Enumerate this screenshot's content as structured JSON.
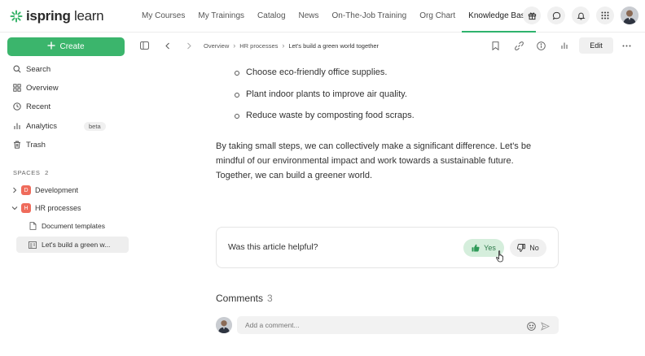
{
  "brand": {
    "name_bold": "ispring",
    "name_light": " learn",
    "color": "#3bb56c"
  },
  "topnav": {
    "items": [
      "My Courses",
      "My Trainings",
      "Catalog",
      "News",
      "On-The-Job Training",
      "Org Chart",
      "Knowledge Base"
    ],
    "active": "Knowledge Base",
    "icons": [
      "gift-icon",
      "chat-icon",
      "bell-icon",
      "apps-grid-icon",
      "user-avatar"
    ]
  },
  "sidebar": {
    "create_label": "Create",
    "items": [
      {
        "label": "Search",
        "icon": "search-icon"
      },
      {
        "label": "Overview",
        "icon": "overview-grid-icon"
      },
      {
        "label": "Recent",
        "icon": "clock-icon"
      },
      {
        "label": "Analytics",
        "icon": "analytics-icon",
        "badge": "beta"
      },
      {
        "label": "Trash",
        "icon": "trash-icon"
      }
    ],
    "spaces_label": "SPACES",
    "spaces_count": "2",
    "spaces": [
      {
        "letter": "D",
        "name": "Development",
        "color": "#ef6b5b",
        "expanded": false
      },
      {
        "letter": "H",
        "name": "HR processes",
        "color": "#ef6b5b",
        "expanded": true
      }
    ],
    "docs": [
      {
        "name": "Document templates",
        "icon": "document-icon"
      },
      {
        "name": "Let's build a green w...",
        "icon": "article-icon",
        "selected": true
      }
    ]
  },
  "breadcrumb": [
    "Overview",
    "HR processes",
    "Let's build a green world together"
  ],
  "toolbar": {
    "edit_label": "Edit"
  },
  "article": {
    "bullets": [
      "Choose eco-friendly office supplies.",
      "Plant indoor plants to improve air quality.",
      "Reduce waste by composting food scraps."
    ],
    "paragraph": "By taking small steps, we can collectively make a significant difference. Let's be mindful of our environmental impact and work towards a sustainable future. Together, we can build a greener world."
  },
  "feedback": {
    "question": "Was this article helpful?",
    "yes": "Yes",
    "no": "No"
  },
  "comments": {
    "title": "Comments",
    "count": "3",
    "placeholder": "Add a comment..."
  }
}
